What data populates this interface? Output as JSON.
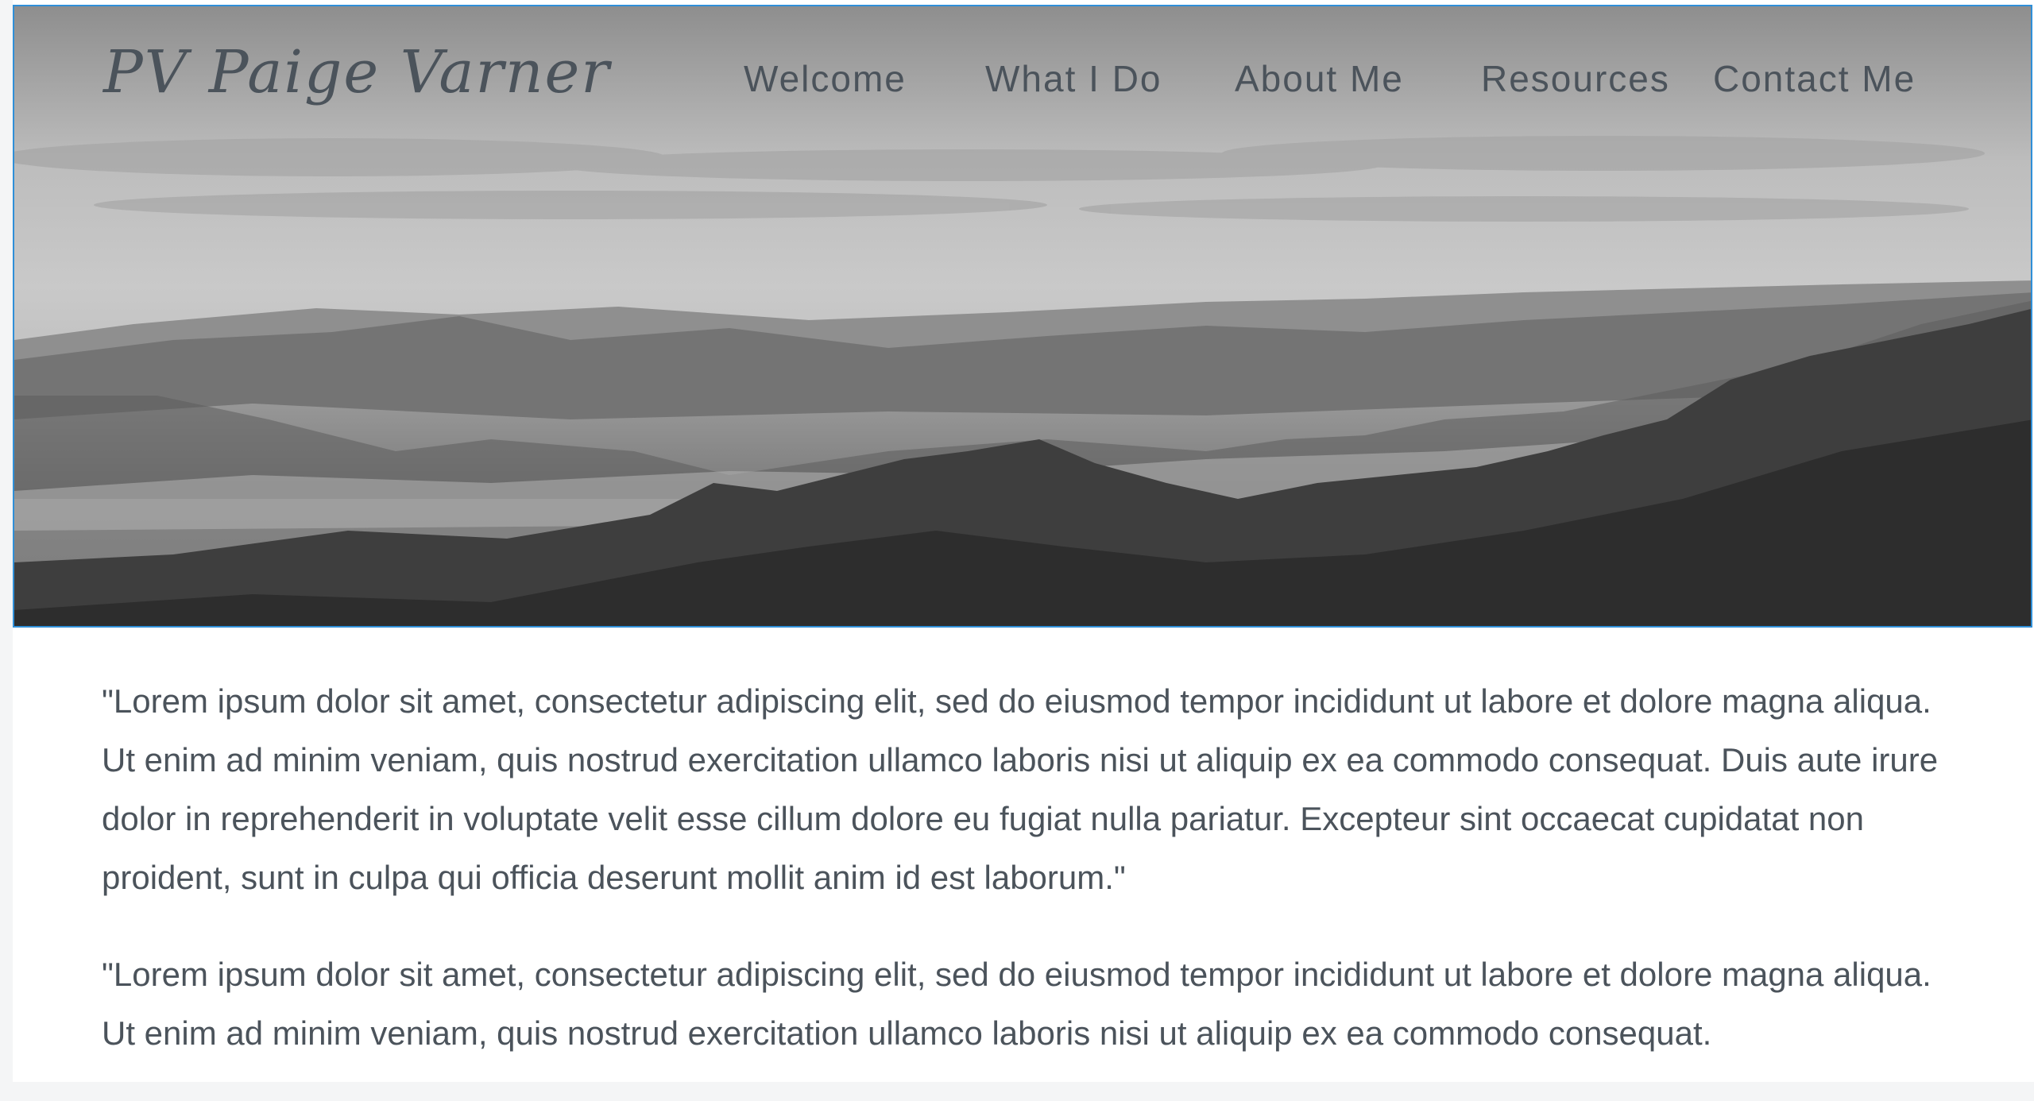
{
  "site": {
    "logo": "PV Paige Varner"
  },
  "nav": {
    "items": [
      {
        "label": "Welcome"
      },
      {
        "label": "What I Do"
      },
      {
        "label": "About Me"
      },
      {
        "label": "Resources"
      },
      {
        "label": "Contact Me"
      }
    ]
  },
  "content": {
    "paragraphs": [
      "\"Lorem ipsum dolor sit amet, consectetur adipiscing elit, sed do eiusmod tempor incididunt ut labore et dolore magna aliqua. Ut enim ad minim veniam, quis nostrud exercitation ullamco laboris nisi ut aliquip ex ea commodo consequat. Duis aute irure dolor in reprehenderit in voluptate velit esse cillum dolore eu fugiat nulla pariatur. Excepteur sint occaecat cupidatat non proident, sunt in culpa qui officia deserunt mollit anim id est laborum.\"",
      "\"Lorem ipsum dolor sit amet, consectetur adipiscing elit, sed do eiusmod tempor incididunt ut labore et dolore magna aliqua. Ut enim ad minim veniam, quis nostrud exercitation ullamco laboris nisi ut aliquip ex ea commodo consequat."
    ]
  }
}
